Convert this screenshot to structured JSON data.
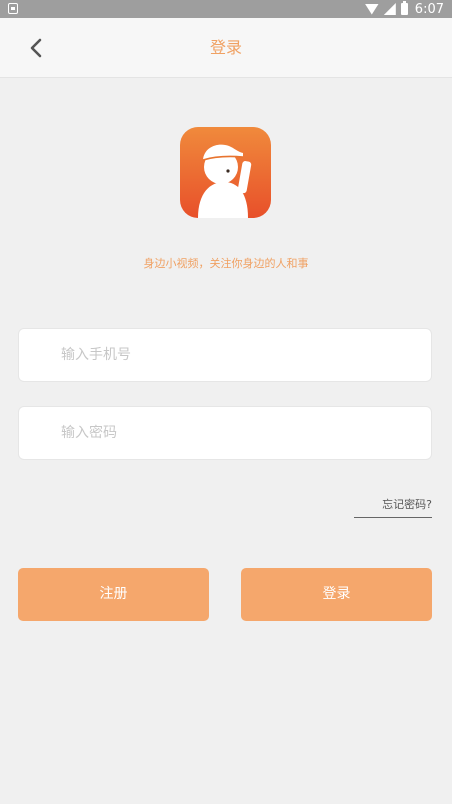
{
  "status_bar": {
    "time": "6:07"
  },
  "nav": {
    "title": "登录",
    "back_icon": "chevron-left-icon"
  },
  "logo": {
    "icon": "app-logo-icon",
    "gradient_top": "#f08a3c",
    "gradient_bottom": "#e8502a"
  },
  "slogan": "身边小视频，关注你身边的人和事",
  "form": {
    "phone_placeholder": "输入手机号",
    "phone_value": "",
    "password_placeholder": "输入密码",
    "password_value": "",
    "forgot_label": "忘记密码?"
  },
  "buttons": {
    "register_label": "注册",
    "login_label": "登录"
  },
  "colors": {
    "accent": "#f0a163",
    "button": "#f5a76c",
    "background": "#f0f0f0"
  }
}
